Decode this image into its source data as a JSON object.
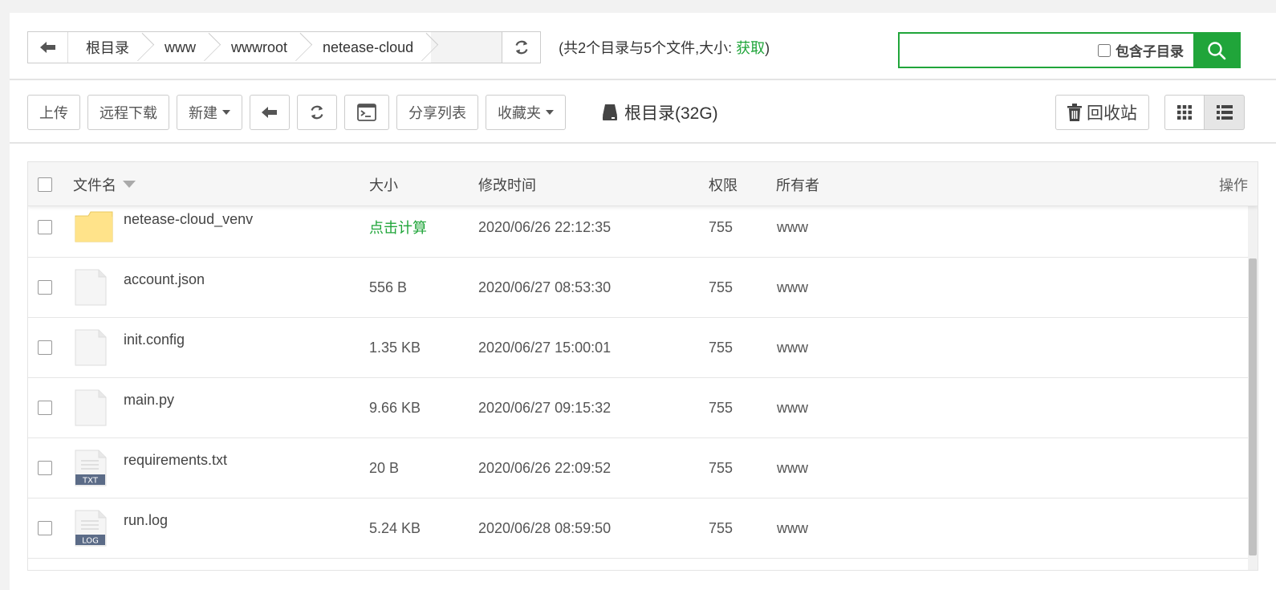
{
  "path": {
    "crumbs": [
      "根目录",
      "www",
      "wwwroot",
      "netease-cloud"
    ]
  },
  "summary": {
    "prefix": "(共2个目录与5个文件,大小: ",
    "link": "获取",
    "suffix": ")"
  },
  "search": {
    "value": "",
    "include_subdir_label": "包含子目录"
  },
  "toolbar": {
    "upload": "上传",
    "remote_download": "远程下载",
    "new": "新建",
    "share_list": "分享列表",
    "favorites": "收藏夹",
    "disk": "根目录(32G)",
    "recycle": "回收站"
  },
  "table": {
    "headers": {
      "name": "文件名",
      "size": "大小",
      "mtime": "修改时间",
      "perm": "权限",
      "owner": "所有者",
      "action": "操作"
    },
    "rows": [
      {
        "name": "netease-cloud_venv",
        "type": "folder",
        "size": "点击计算",
        "mtime": "2020/06/26 22:12:35",
        "perm": "755",
        "owner": "www"
      },
      {
        "name": "account.json",
        "type": "file",
        "size": "556 B",
        "mtime": "2020/06/27 08:53:30",
        "perm": "755",
        "owner": "www"
      },
      {
        "name": "init.config",
        "type": "file",
        "size": "1.35 KB",
        "mtime": "2020/06/27 15:00:01",
        "perm": "755",
        "owner": "www"
      },
      {
        "name": "main.py",
        "type": "file",
        "size": "9.66 KB",
        "mtime": "2020/06/27 09:15:32",
        "perm": "755",
        "owner": "www"
      },
      {
        "name": "requirements.txt",
        "type": "txt",
        "size": "20 B",
        "mtime": "2020/06/26 22:09:52",
        "perm": "755",
        "owner": "www"
      },
      {
        "name": "run.log",
        "type": "log",
        "size": "5.24 KB",
        "mtime": "2020/06/28 08:59:50",
        "perm": "755",
        "owner": "www"
      }
    ]
  },
  "file_badges": {
    "txt": "TXT",
    "log": "LOG"
  },
  "colors": {
    "accent": "#20a53a",
    "folder": "#ffe38a"
  }
}
